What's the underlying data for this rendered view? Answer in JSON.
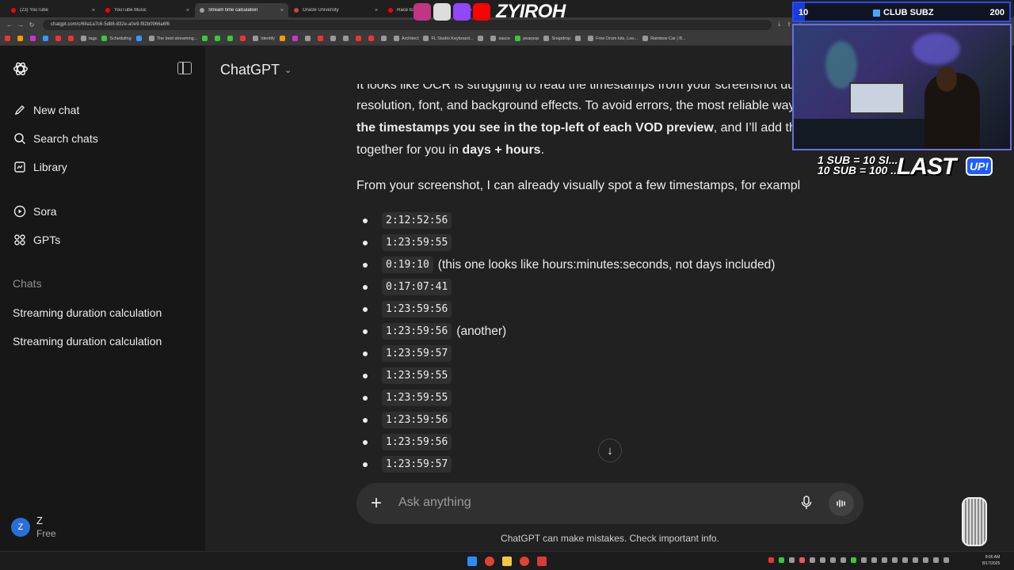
{
  "browser": {
    "tabs": [
      {
        "label": "(23) YouTube",
        "color": "#ff0000",
        "active": false
      },
      {
        "label": "YouTube Music",
        "color": "#ff0000",
        "active": false
      },
      {
        "label": "Stream time calculation",
        "color": "#9aa0a6",
        "active": true
      },
      {
        "label": "Oracle University",
        "color": "#c74634",
        "active": false
      },
      {
        "label": "Race to C...",
        "color": "#ff0000",
        "active": false
      }
    ],
    "url": "chatgpt.com/c/68a1a7c6-5d88-832e-a0e9-f82b0966a6f6",
    "bookmarks": [
      "",
      "",
      "",
      "",
      "",
      "",
      "tags",
      "Scheduling",
      "",
      "The best streaming...",
      "",
      "",
      "",
      "",
      "Identify",
      "",
      "",
      "",
      "",
      "",
      "",
      "",
      "",
      "",
      "Architect",
      "FL Studio Keyboard...",
      "",
      "sauce",
      "pearpop",
      "Snapdrop",
      "",
      "Free Drum kits, Loo...",
      "Rainbow Car | B..."
    ]
  },
  "sidebar": {
    "items": [
      {
        "label": "New chat",
        "icon": "edit-icon"
      },
      {
        "label": "Search chats",
        "icon": "search-icon"
      },
      {
        "label": "Library",
        "icon": "library-icon"
      },
      {
        "label": "Sora",
        "icon": "play-icon"
      },
      {
        "label": "GPTs",
        "icon": "grid-icon"
      }
    ],
    "section_label": "Chats",
    "chats": [
      "Streaming duration calculation",
      "Streaming duration calculation"
    ],
    "user": {
      "initial": "Z",
      "name": "Z",
      "plan": "Free"
    }
  },
  "header": {
    "title": "ChatGPT"
  },
  "message": {
    "line0": "It looks like OCR is struggling to read the timestamps from your screenshot due to",
    "line1": "resolution, font, and background effects. To avoid errors, the most reliable way",
    "line2_bold": "the timestamps you see in the top-left of each VOD preview",
    "line2_rest": ", and I’ll add them",
    "line3_a": "together for you in ",
    "line3_bold": "days + hours",
    "line3_end": ".",
    "intro": "From your screenshot, I can already visually spot a few timestamps, for example:",
    "timestamps": [
      {
        "code": "2:12:52:56",
        "note": ""
      },
      {
        "code": "1:23:59:55",
        "note": ""
      },
      {
        "code": "0:19:10",
        "note": "(this one looks like hours:minutes:seconds, not days included)"
      },
      {
        "code": "0:17:07:41",
        "note": ""
      },
      {
        "code": "1:23:59:56",
        "note": ""
      },
      {
        "code": "1:23:59:56",
        "note": "(another)"
      },
      {
        "code": "1:23:59:57",
        "note": ""
      },
      {
        "code": "1:23:59:55",
        "note": ""
      },
      {
        "code": "1:23:59:55",
        "note": ""
      },
      {
        "code": "1:23:59:56",
        "note": ""
      },
      {
        "code": "1:23:59:56",
        "note": ""
      },
      {
        "code": "1:23:59:57",
        "note": ""
      }
    ]
  },
  "composer": {
    "placeholder": "Ask anything"
  },
  "disclaimer": "ChatGPT can make mistakes. Check important info.",
  "clock": {
    "time": "8:06 AM",
    "date": "8/17/2025"
  },
  "overlay": {
    "brand": "ZYIROH",
    "sub_current": "10",
    "sub_label": "CLUB SUBZ",
    "sub_goal": "200",
    "sub_progress": 0.05,
    "goal_line1": "1 SUB = 10 SI...",
    "goal_line2": "10 SUB = 100 ...",
    "last_text": "LAST",
    "up_text": "UP!"
  }
}
